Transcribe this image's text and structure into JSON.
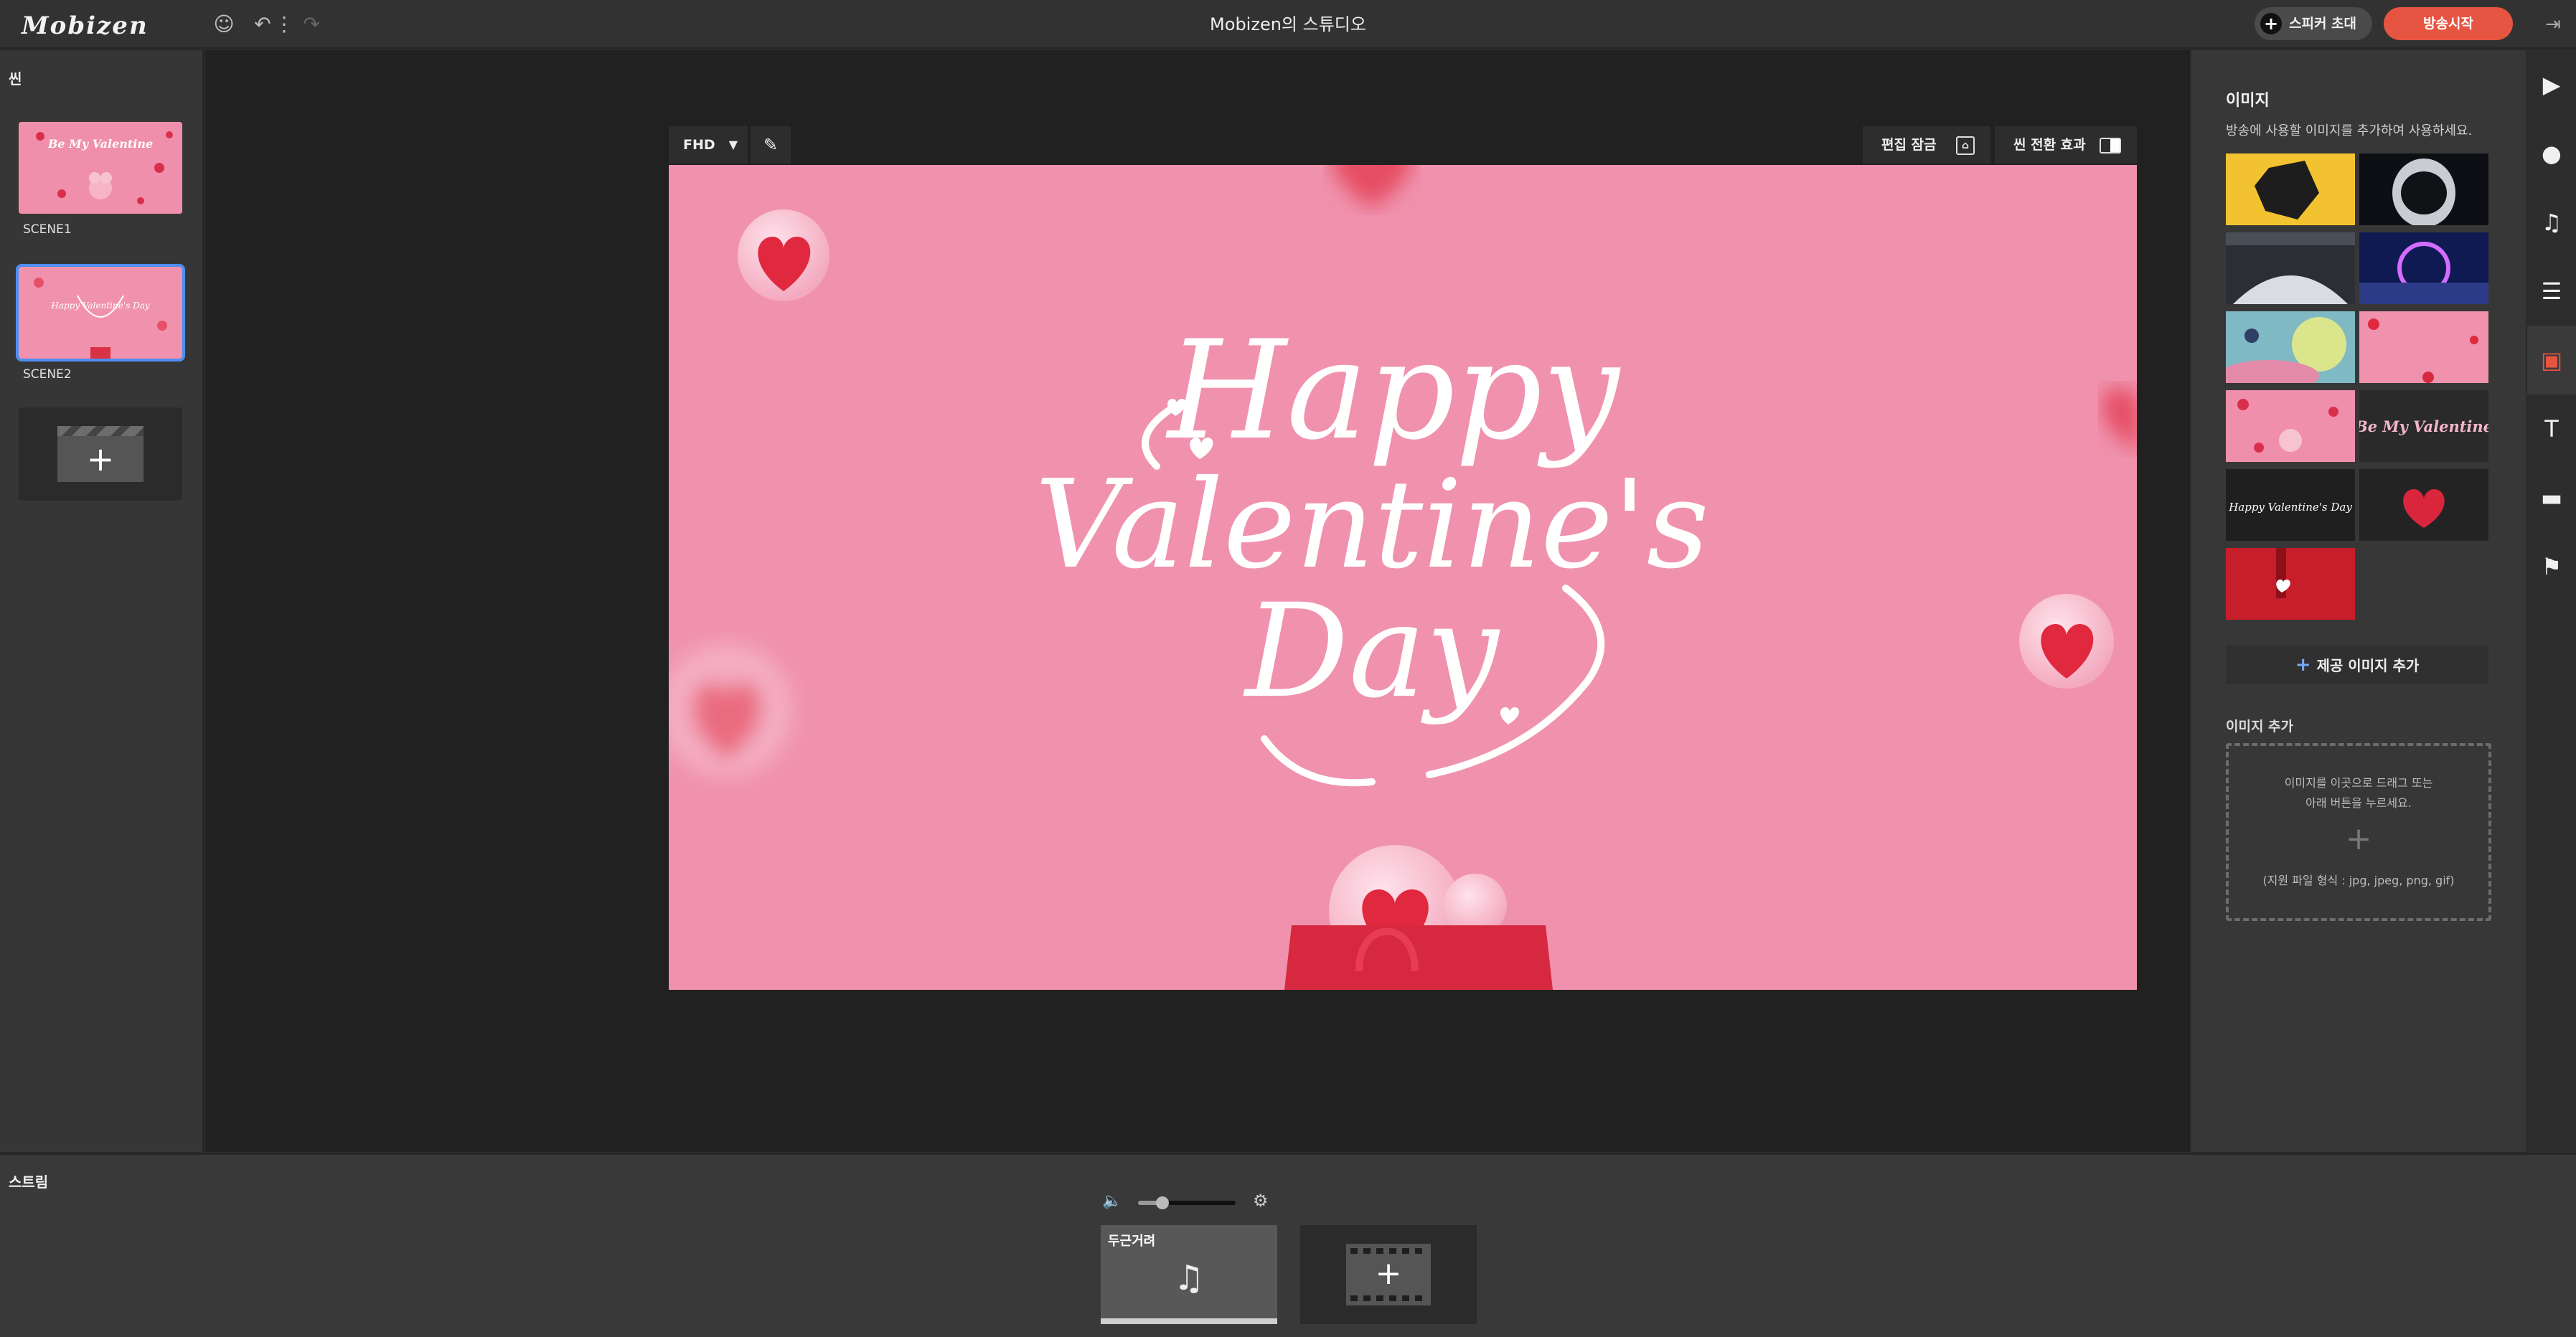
{
  "topbar": {
    "logo": "Mobizen",
    "title": "Mobizen의 스튜디오",
    "invite_label": "스피커 초대",
    "live_label": "방송시작"
  },
  "scenes": {
    "title": "씬",
    "items": [
      {
        "label": "SCENE1",
        "thumb_text": "Be My Valentine"
      },
      {
        "label": "SCENE2",
        "thumb_text": "Happy Valentine's Day"
      }
    ],
    "selected_index": 1
  },
  "canvas_toolbar": {
    "resolution": "FHD",
    "edit_lock_label": "편집 잠금",
    "scene_transition_label": "씬 전환 효과"
  },
  "canvas": {
    "text": [
      "Happy",
      "Valentine's",
      "Day"
    ],
    "background": "#f092ad"
  },
  "image_panel": {
    "title": "이미지",
    "description": "방송에 사용할 이미지를 추가하여 사용하세요.",
    "tile_texts": [
      "Be My Valentine",
      "Happy Valentine's Day"
    ],
    "add_provided_label": "제공 이미지 추가",
    "add_image_label": "이미지 추가",
    "drop_text_line1": "이미지를 이곳으로 드래그 또는",
    "drop_text_line2": "아래 버튼을 누르세요.",
    "formats": "(지원 파일 형식 : jpg, jpeg, png, gif)"
  },
  "rail": {
    "icons": [
      "play-icon",
      "chat-icon",
      "music-icon",
      "layout-icon",
      "image-icon",
      "text-icon",
      "caption-icon",
      "bookmark-icon"
    ],
    "active": "image-icon"
  },
  "stream": {
    "title": "스트림",
    "volume": 0.25,
    "bgm_label": "두근거려"
  },
  "colors": {
    "accent": "#e65541",
    "selection": "#4d8ff0",
    "canvas_pink": "#f092ad"
  }
}
